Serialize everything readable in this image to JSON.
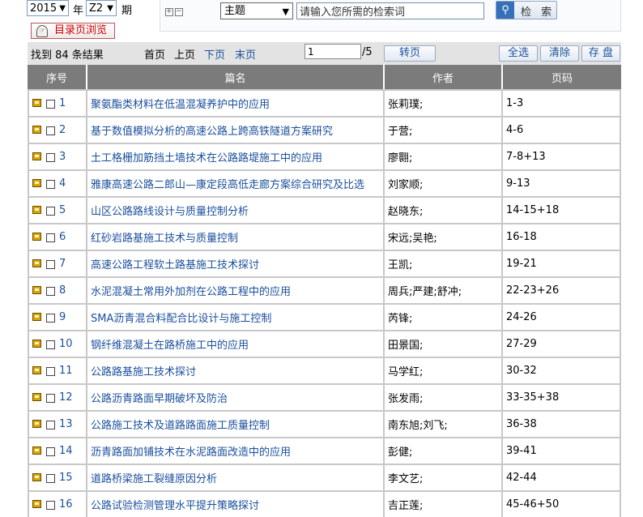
{
  "filters": {
    "year": "2015",
    "year_label": "年",
    "issue": "Z2",
    "issue_label": "期",
    "browse_label": "目录页浏览"
  },
  "search": {
    "expand_icons": "⊞⊟",
    "field": "主题",
    "query": "请输入您所需的检索词",
    "button_label": "检 索"
  },
  "results": {
    "found_text": "找到 84 条结果",
    "first": "首页",
    "prev": "上页",
    "next": "下页",
    "last": "末页",
    "page_value": "1",
    "page_total": "/5",
    "go": "转页",
    "select_all": "全选",
    "clear": "清除",
    "save": "存 盘"
  },
  "table": {
    "headers": [
      "序号",
      "篇名",
      "作者",
      "页码"
    ],
    "rows": [
      {
        "no": "1",
        "title": "聚氨酯类材料在低温混凝养护中的应用",
        "author": "张莉璞;",
        "pages": "1-3"
      },
      {
        "no": "2",
        "title": "基于数值模拟分析的高速公路上跨高铁隧道方案研究",
        "author": "于营;",
        "pages": "4-6"
      },
      {
        "no": "3",
        "title": "土工格栅加筋挡土墙技术在公路路堤施工中的应用",
        "author": "廖翾;",
        "pages": "7-8+13"
      },
      {
        "no": "4",
        "title": "雅康高速公路二郎山—康定段高低走廊方案综合研究及比选",
        "author": "刘家顺;",
        "pages": "9-13"
      },
      {
        "no": "5",
        "title": "山区公路路线设计与质量控制分析",
        "author": "赵晓东;",
        "pages": "14-15+18"
      },
      {
        "no": "6",
        "title": "红砂岩路基施工技术与质量控制",
        "author": "宋远;吴艳;",
        "pages": "16-18"
      },
      {
        "no": "7",
        "title": "高速公路工程软土路基施工技术探讨",
        "author": "王凯;",
        "pages": "19-21"
      },
      {
        "no": "8",
        "title": "水泥混凝土常用外加剂在公路工程中的应用",
        "author": "周兵;严建;舒冲;",
        "pages": "22-23+26"
      },
      {
        "no": "9",
        "title": "SMA沥青混合料配合比设计与施工控制",
        "author": "芮锋;",
        "pages": "24-26"
      },
      {
        "no": "10",
        "title": "钢纤维混凝土在路桥施工中的应用",
        "author": "田景国;",
        "pages": "27-29"
      },
      {
        "no": "11",
        "title": "公路路基施工技术探讨",
        "author": "马学红;",
        "pages": "30-32"
      },
      {
        "no": "12",
        "title": "公路沥青路面早期破坏及防治",
        "author": "张发雨;",
        "pages": "33-35+38"
      },
      {
        "no": "13",
        "title": "公路施工技术及道路路面施工质量控制",
        "author": "南东旭;刘飞;",
        "pages": "36-38"
      },
      {
        "no": "14",
        "title": "沥青路面加铺技术在水泥路面改造中的应用",
        "author": "彭健;",
        "pages": "39-41"
      },
      {
        "no": "15",
        "title": "道路桥梁施工裂缝原因分析",
        "author": "李文艺;",
        "pages": "42-44"
      },
      {
        "no": "16",
        "title": "公路试验检测管理水平提升策略探讨",
        "author": "吉正莲;",
        "pages": "45-46+50"
      }
    ]
  }
}
